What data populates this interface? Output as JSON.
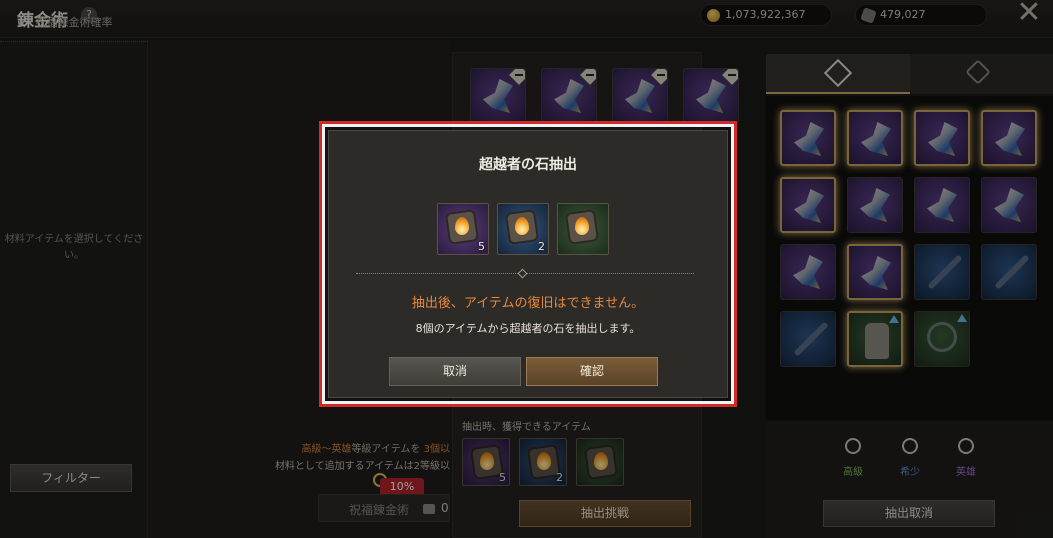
{
  "header": {
    "title": "錬金術",
    "help_icon": "?",
    "gold_amount": "1,073,922,367",
    "stone_amount": "479,027",
    "close_icon": "✕"
  },
  "left_panel": {
    "heading": "祝福錬金術確率",
    "empty_message": "材料アイテムを選択してください。",
    "filter_label": "フィルター"
  },
  "middle_panel": {
    "chance_prefix": "高級～英雄",
    "chance_mid": "等級アイテムを ",
    "chance_count": "3個以",
    "chance_line2": "材料として追加するアイテムは2等級以",
    "rate_badge": "10%",
    "blessed_label": "祝福錬金術",
    "blessed_count": "0"
  },
  "center_panel": {
    "obtain_label": "抽出時、獲得できるアイテム",
    "rewards": [
      {
        "grade": "purple",
        "count": "5"
      },
      {
        "grade": "blue",
        "count": "2"
      },
      {
        "grade": "green",
        "count": ""
      }
    ],
    "extract_button": "抽出挑戦"
  },
  "right_panel": {
    "grades": [
      {
        "label": "高級",
        "color": "#7fbf5a"
      },
      {
        "label": "希少",
        "color": "#5d8fd6"
      },
      {
        "label": "英雄",
        "color": "#9b72d6"
      }
    ],
    "cancel_extract_button": "抽出取消"
  },
  "modal": {
    "title": "超越者の石抽出",
    "stones": [
      {
        "grade": "purple",
        "count": "5"
      },
      {
        "grade": "blue",
        "count": "2"
      },
      {
        "grade": "green",
        "count": ""
      }
    ],
    "warning": "抽出後、アイテムの復旧はできません。",
    "info": "8個のアイテムから超越者の石を抽出します。",
    "cancel_button": "取消",
    "confirm_button": "確認"
  },
  "colors": {
    "accent_gold": "#c5a45f",
    "warning_orange": "#e8883e",
    "highlight_red": "#d12a2a"
  }
}
